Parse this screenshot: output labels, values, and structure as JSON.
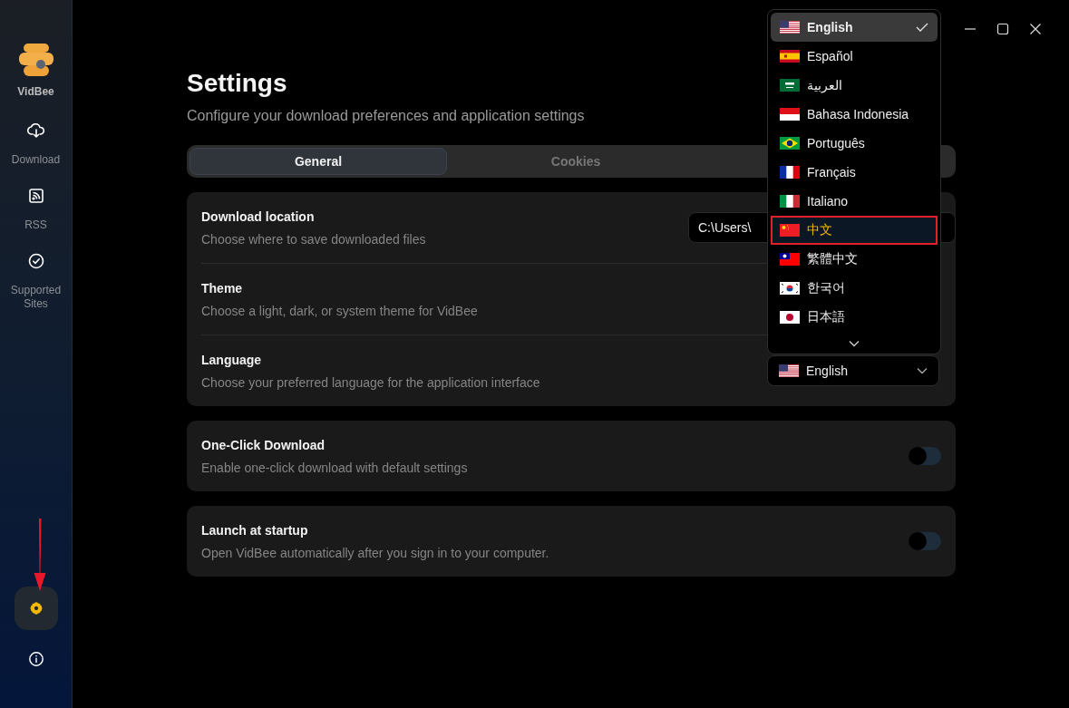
{
  "app": {
    "name": "VidBee"
  },
  "sidebar": {
    "items": [
      {
        "label": "Download",
        "selected": false,
        "kind": "download"
      },
      {
        "label": "RSS",
        "selected": false,
        "kind": "rss"
      },
      {
        "label": "Supported Sites",
        "selected": false,
        "kind": "sites"
      }
    ],
    "bottom_buttons": [
      {
        "kind": "settings",
        "selected": true
      },
      {
        "kind": "info",
        "selected": false
      }
    ]
  },
  "page": {
    "title": "Settings",
    "subtitle": "Configure your download preferences and application settings"
  },
  "tabs": [
    {
      "label": "General",
      "selected": true
    },
    {
      "label": "Cookies",
      "selected": false
    }
  ],
  "general": {
    "rows": [
      {
        "kind": "path",
        "title": "Download location",
        "description": "Choose where to save downloaded files",
        "value": "C:\\Users\\"
      },
      {
        "kind": "hidden",
        "title": "Theme",
        "description": "Choose a light, dark, or system theme for VidBee"
      },
      {
        "kind": "select",
        "title": "Language",
        "description": "Choose your preferred language for the application interface",
        "value": "English"
      }
    ]
  },
  "toggles": [
    {
      "title": "One-Click Download",
      "description": "Enable one-click download with default settings",
      "on": false
    },
    {
      "title": "Launch at startup",
      "description": "Open VidBee automatically after you sign in to your computer.",
      "on": false
    }
  ],
  "language_menu": {
    "items": [
      {
        "label": "English",
        "selected": true,
        "highlighted": false
      },
      {
        "label": "Español",
        "selected": false,
        "highlighted": false
      },
      {
        "label": "العربية",
        "selected": false,
        "highlighted": false
      },
      {
        "label": "Bahasa Indonesia",
        "selected": false,
        "highlighted": false
      },
      {
        "label": "Português",
        "selected": false,
        "highlighted": false
      },
      {
        "label": "Français",
        "selected": false,
        "highlighted": false
      },
      {
        "label": "Italiano",
        "selected": false,
        "highlighted": false
      },
      {
        "label": "中文",
        "selected": false,
        "highlighted": true
      },
      {
        "label": "繁體中文",
        "selected": false,
        "highlighted": false
      },
      {
        "label": "한국어",
        "selected": false,
        "highlighted": false
      },
      {
        "label": "日本語",
        "selected": false,
        "highlighted": false
      }
    ]
  }
}
